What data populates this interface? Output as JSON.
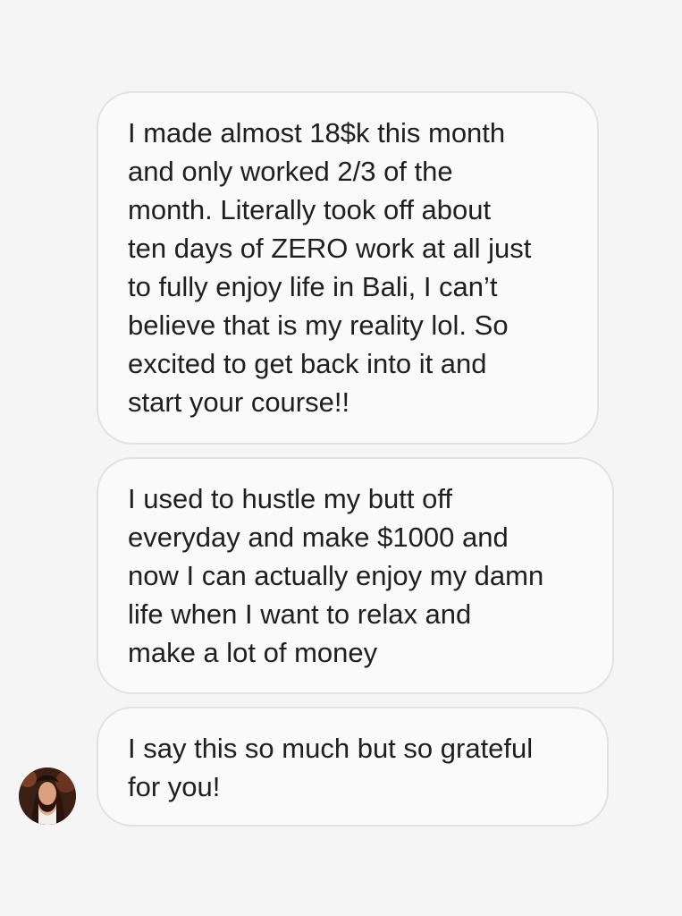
{
  "messages": [
    {
      "lines": [
        "I made almost 18$k this month",
        "and only worked 2/3 of the",
        "month. Literally took off about",
        "ten days of ZERO work at all just",
        "to fully enjoy life in Bali, I can’t",
        "believe that is my reality lol. So",
        "excited to get back into it and",
        "start your course!!"
      ]
    },
    {
      "lines": [
        "I used to hustle my butt off",
        "everyday and make $1000 and",
        "now I can actually enjoy my damn",
        "life when I want to relax and",
        "make a lot of money"
      ]
    },
    {
      "lines": [
        "I say this so much but so grateful",
        "for you!"
      ]
    }
  ],
  "avatar": {
    "icon": "profile-photo-avatar"
  },
  "colors": {
    "background": "#f5f5f5",
    "bubble_background": "#fafafa",
    "bubble_border": "#e2e2e2",
    "text": "#1f1f1f"
  }
}
